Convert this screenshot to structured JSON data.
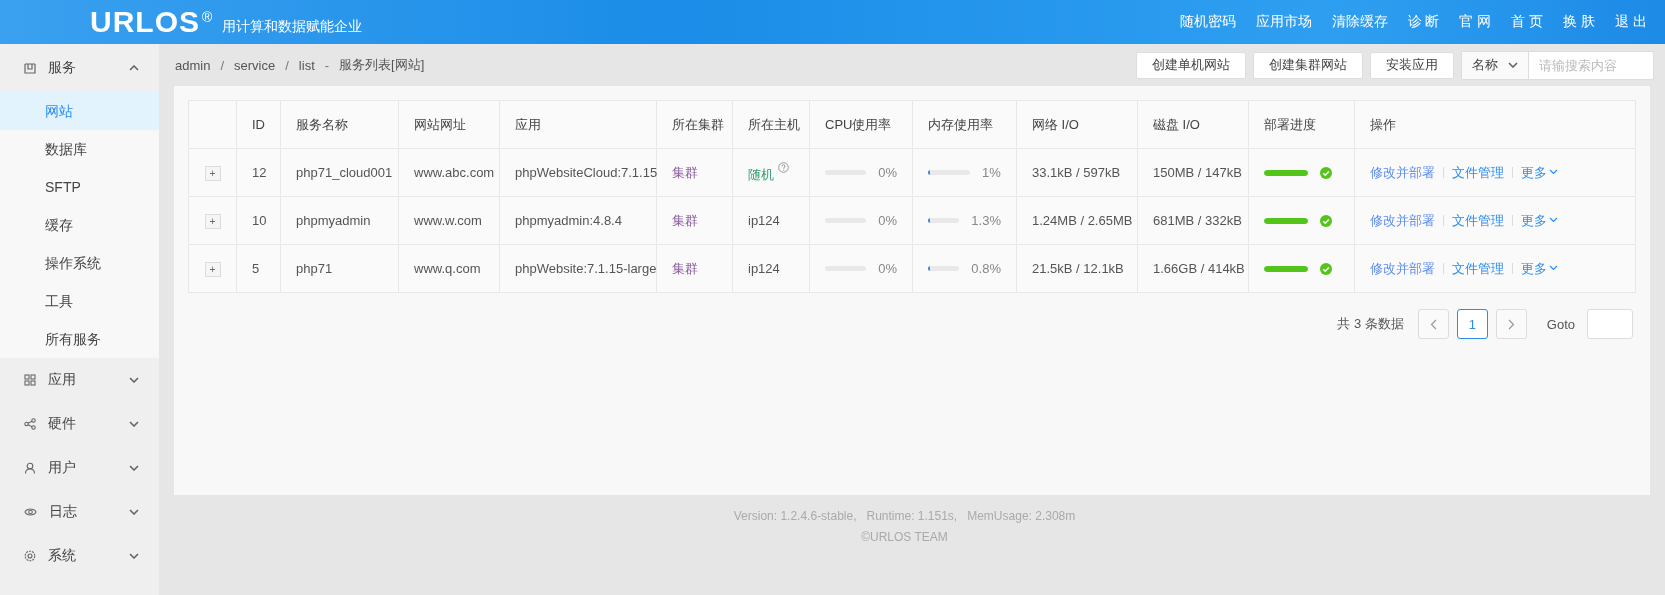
{
  "header": {
    "logo": "URLOS",
    "registered": "®",
    "slogan": "用计算和数据赋能企业",
    "nav": [
      "随机密码",
      "应用市场",
      "清除缓存",
      "诊 断",
      "官 网",
      "首 页",
      "换 肤",
      "退 出"
    ]
  },
  "sidebar": {
    "groups": [
      {
        "label": "服务",
        "expanded": true,
        "children": [
          {
            "label": "网站",
            "selected": true
          },
          {
            "label": "数据库",
            "selected": false
          },
          {
            "label": "SFTP",
            "selected": false
          },
          {
            "label": "缓存",
            "selected": false
          },
          {
            "label": "操作系统",
            "selected": false
          },
          {
            "label": "工具",
            "selected": false
          },
          {
            "label": "所有服务",
            "selected": false
          }
        ]
      },
      {
        "label": "应用",
        "expanded": false
      },
      {
        "label": "硬件",
        "expanded": false
      },
      {
        "label": "用户",
        "expanded": false
      },
      {
        "label": "日志",
        "expanded": false
      },
      {
        "label": "系统",
        "expanded": false
      }
    ]
  },
  "breadcrumb": {
    "parts": [
      "admin",
      "service",
      "list"
    ],
    "separator": "/",
    "title_separator": "-",
    "title": "服务列表[网站]"
  },
  "toolbar": {
    "buttons": [
      "创建单机网站",
      "创建集群网站",
      "安装应用"
    ],
    "search_field": "名称",
    "search_placeholder": "请输搜索内容"
  },
  "table": {
    "columns": [
      "ID",
      "服务名称",
      "网站网址",
      "应用",
      "所在集群",
      "所在主机",
      "CPU使用率",
      "内存使用率",
      "网络 I/O",
      "磁盘 I/O",
      "部署进度",
      "操作"
    ],
    "rows": [
      {
        "expand": "+",
        "id": "12",
        "name": "php71_cloud001",
        "url": "www.abc.com",
        "app": "phpWebsiteCloud:7.1.15",
        "cluster": "集群",
        "host": {
          "text": "随机",
          "kind": "random"
        },
        "cpu": {
          "level": 0,
          "reading": "0%"
        },
        "memory": {
          "level": 0.01,
          "reading": "1%"
        },
        "net_io": "33.1kB / 597kB",
        "disk_io": "150MB / 147kB",
        "deploy": {
          "level": 1
        },
        "actions": [
          "修改并部署",
          "文件管理",
          "更多"
        ]
      },
      {
        "expand": "+",
        "id": "10",
        "name": "phpmyadmin",
        "url": "www.w.com",
        "app": "phpmyadmin:4.8.4",
        "cluster": "集群",
        "host": {
          "text": "ip124",
          "kind": "fixed"
        },
        "cpu": {
          "level": 0,
          "reading": "0%"
        },
        "memory": {
          "level": 0.013,
          "reading": "1.3%"
        },
        "net_io": "1.24MB / 2.65MB",
        "disk_io": "681MB / 332kB",
        "deploy": {
          "level": 1
        },
        "actions": [
          "修改并部署",
          "文件管理",
          "更多"
        ]
      },
      {
        "expand": "+",
        "id": "5",
        "name": "php71",
        "url": "www.q.com",
        "app": "phpWebsite:7.1.15-large",
        "cluster": "集群",
        "host": {
          "text": "ip124",
          "kind": "fixed"
        },
        "cpu": {
          "level": 0,
          "reading": "0%"
        },
        "memory": {
          "level": 0.008,
          "reading": "0.8%"
        },
        "net_io": "21.5kB / 12.1kB",
        "disk_io": "1.66GB / 414kB",
        "deploy": {
          "level": 1
        },
        "actions": [
          "修改并部署",
          "文件管理",
          "更多"
        ]
      }
    ]
  },
  "pagination": {
    "total": "共 3 条数据",
    "pages": [
      {
        "label": "1",
        "selected": true
      }
    ],
    "goto_label": "Goto"
  },
  "footer": {
    "line_1": "Version: 1.2.4.6-stable,   Runtime: 1.151s,   MemUsage: 2.308m",
    "line_2": "©URLOS TEAM"
  }
}
